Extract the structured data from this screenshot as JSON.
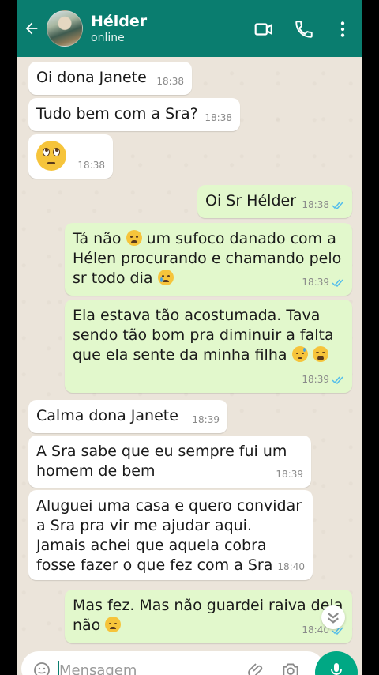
{
  "header": {
    "contact_name": "Hélder",
    "status": "online",
    "icons": [
      "back-arrow-icon",
      "video-call-icon",
      "phone-call-icon",
      "more-options-icon"
    ]
  },
  "messages": [
    {
      "dir": "in",
      "text": "Oi dona Janete",
      "time": "18:38"
    },
    {
      "dir": "in",
      "text": "Tudo bem com a Sra?",
      "time": "18:38"
    },
    {
      "dir": "in",
      "text": "",
      "emoji": "rolling-eyes-emoji",
      "time": "18:38"
    },
    {
      "dir": "out",
      "text": "Oi Sr Hélder",
      "time": "18:38"
    },
    {
      "dir": "out",
      "text_parts": [
        "Tá não",
        "um sufoco danado com a Hélen procurando e chamando pelo sr todo dia"
      ],
      "time": "18:39"
    },
    {
      "dir": "out",
      "text": "Ela estava tão acostumada. Tava sendo tão bom pra diminuir a falta que ela sente da minha filha",
      "time": "18:39"
    },
    {
      "dir": "in",
      "text": "Calma dona Janete",
      "time": "18:39"
    },
    {
      "dir": "in",
      "text": "A Sra sabe que eu sempre fui um homem de bem",
      "time": "18:39"
    },
    {
      "dir": "in",
      "text": "Aluguei uma casa e quero convidar a Sra pra vir me ajudar aqui. Jamais achei que aquela cobra fosse fazer o que fez com a Sra",
      "time": "18:40"
    },
    {
      "dir": "out",
      "text": "Mas fez. Mas não guardei raiva dela não",
      "time": "18:40"
    }
  ],
  "composer": {
    "placeholder": "Mensagem"
  },
  "colors": {
    "header": "#0a7d6f",
    "outgoing_bubble": "#e2f8cc",
    "incoming_bubble": "#ffffff",
    "chat_bg": "#ebe4da",
    "read_ticks": "#53bdeb",
    "mic_button": "#00a884"
  }
}
